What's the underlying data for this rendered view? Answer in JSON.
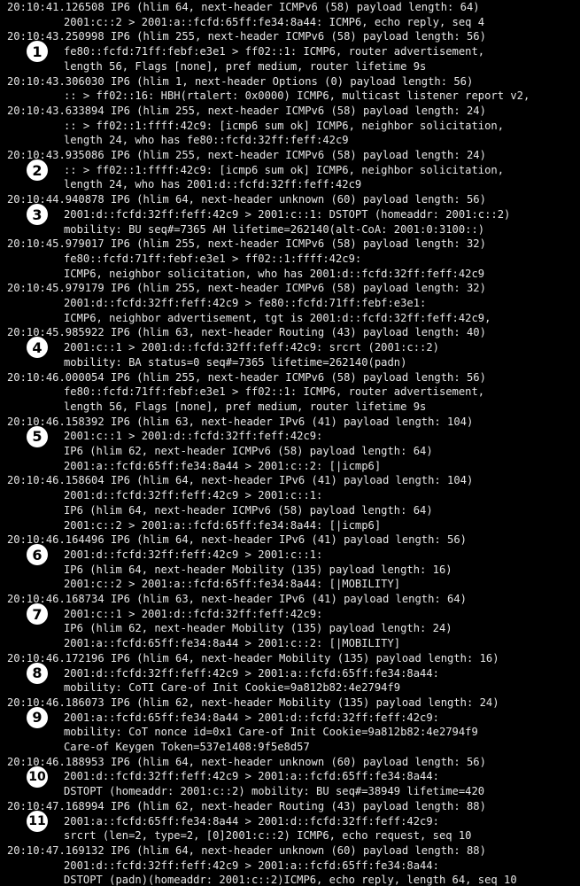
{
  "terminal": {
    "lines": [
      {
        "text": "20:10:41.126508 IP6 (hlim 64, next-header ICMPv6 (58) payload length: 64)",
        "indent": false
      },
      {
        "text": "2001:c::2 > 2001:a::fcfd:65ff:fe34:8a44: ICMP6, echo reply, seq 4",
        "indent": true
      },
      {
        "text": "20:10:43.250998 IP6 (hlim 255, next-header ICMPv6 (58) payload length: 56)",
        "indent": false
      },
      {
        "text": "fe80::fcfd:71ff:febf:e3e1 > ff02::1: ICMP6, router advertisement,",
        "indent": true
      },
      {
        "text": "length 56, Flags [none], pref medium, router lifetime 9s",
        "indent": true
      },
      {
        "text": "20:10:43.306030 IP6 (hlim 1, next-header Options (0) payload length: 56)",
        "indent": false
      },
      {
        "text": ":: > ff02::16: HBH(rtalert: 0x0000) ICMP6, multicast listener report v2,",
        "indent": true
      },
      {
        "text": "20:10:43.633894 IP6 (hlim 255, next-header ICMPv6 (58) payload length: 24)",
        "indent": false
      },
      {
        "text": ":: > ff02::1:ffff:42c9: [icmp6 sum ok] ICMP6, neighbor solicitation,",
        "indent": true
      },
      {
        "text": "length 24, who has fe80::fcfd:32ff:feff:42c9",
        "indent": true
      },
      {
        "text": "20:10:43.935086 IP6 (hlim 255, next-header ICMPv6 (58) payload length: 24)",
        "indent": false
      },
      {
        "text": ":: > ff02::1:ffff:42c9: [icmp6 sum ok] ICMP6, neighbor solicitation,",
        "indent": true
      },
      {
        "text": "length 24, who has 2001:d::fcfd:32ff:feff:42c9",
        "indent": true
      },
      {
        "text": "20:10:44.940878 IP6 (hlim 64, next-header unknown (60) payload length: 56)",
        "indent": false
      },
      {
        "text": "2001:d::fcfd:32ff:feff:42c9 > 2001:c::1: DSTOPT (homeaddr: 2001:c::2)",
        "indent": true
      },
      {
        "text": "mobility: BU seq#=7365 AH lifetime=262140(alt-CoA: 2001:0:3100::)",
        "indent": true
      },
      {
        "text": "20:10:45.979017 IP6 (hlim 255, next-header ICMPv6 (58) payload length: 32)",
        "indent": false
      },
      {
        "text": "fe80::fcfd:71ff:febf:e3e1 > ff02::1:ffff:42c9:",
        "indent": true
      },
      {
        "text": "ICMP6, neighbor solicitation, who has 2001:d::fcfd:32ff:feff:42c9",
        "indent": true
      },
      {
        "text": "20:10:45.979179 IP6 (hlim 255, next-header ICMPv6 (58) payload length: 32)",
        "indent": false
      },
      {
        "text": "2001:d::fcfd:32ff:feff:42c9 > fe80::fcfd:71ff:febf:e3e1:",
        "indent": true
      },
      {
        "text": "ICMP6, neighbor advertisement, tgt is 2001:d::fcfd:32ff:feff:42c9,",
        "indent": true
      },
      {
        "text": "20:10:45.985922 IP6 (hlim 63, next-header Routing (43) payload length: 40)",
        "indent": false
      },
      {
        "text": "2001:c::1 > 2001:d::fcfd:32ff:feff:42c9: srcrt (2001:c::2)",
        "indent": true
      },
      {
        "text": "mobility: BA status=0 seq#=7365 lifetime=262140(padn)",
        "indent": true
      },
      {
        "text": "20:10:46.000054 IP6 (hlim 255, next-header ICMPv6 (58) payload length: 56)",
        "indent": false
      },
      {
        "text": "fe80::fcfd:71ff:febf:e3e1 > ff02::1: ICMP6, router advertisement,",
        "indent": true
      },
      {
        "text": "length 56, Flags [none], pref medium, router lifetime 9s",
        "indent": true
      },
      {
        "text": "20:10:46.158392 IP6 (hlim 63, next-header IPv6 (41) payload length: 104)",
        "indent": false
      },
      {
        "text": "2001:c::1 > 2001:d::fcfd:32ff:feff:42c9:",
        "indent": true
      },
      {
        "text": "IP6 (hlim 62, next-header ICMPv6 (58) payload length: 64)",
        "indent": true
      },
      {
        "text": "2001:a::fcfd:65ff:fe34:8a44 > 2001:c::2: [|icmp6]",
        "indent": true
      },
      {
        "text": "20:10:46.158604 IP6 (hlim 64, next-header IPv6 (41) payload length: 104)",
        "indent": false
      },
      {
        "text": "2001:d::fcfd:32ff:feff:42c9 > 2001:c::1:",
        "indent": true
      },
      {
        "text": "IP6 (hlim 64, next-header ICMPv6 (58) payload length: 64)",
        "indent": true
      },
      {
        "text": "2001:c::2 > 2001:a::fcfd:65ff:fe34:8a44: [|icmp6]",
        "indent": true
      },
      {
        "text": "20:10:46.164496 IP6 (hlim 64, next-header IPv6 (41) payload length: 56)",
        "indent": false
      },
      {
        "text": "2001:d::fcfd:32ff:feff:42c9 > 2001:c::1:",
        "indent": true
      },
      {
        "text": "IP6 (hlim 64, next-header Mobility (135) payload length: 16)",
        "indent": true
      },
      {
        "text": "2001:c::2 > 2001:a::fcfd:65ff:fe34:8a44: [|MOBILITY]",
        "indent": true
      },
      {
        "text": "20:10:46.168734 IP6 (hlim 63, next-header IPv6 (41) payload length: 64)",
        "indent": false
      },
      {
        "text": "2001:c::1 > 2001:d::fcfd:32ff:feff:42c9:",
        "indent": true
      },
      {
        "text": "IP6 (hlim 62, next-header Mobility (135) payload length: 24)",
        "indent": true
      },
      {
        "text": "2001:a::fcfd:65ff:fe34:8a44 > 2001:c::2: [|MOBILITY]",
        "indent": true
      },
      {
        "text": "20:10:46.172196 IP6 (hlim 64, next-header Mobility (135) payload length: 16)",
        "indent": false
      },
      {
        "text": "2001:d::fcfd:32ff:feff:42c9 > 2001:a::fcfd:65ff:fe34:8a44:",
        "indent": true
      },
      {
        "text": "mobility: CoTI Care-of Init Cookie=9a812b82:4e2794f9",
        "indent": true
      },
      {
        "text": "20:10:46.186073 IP6 (hlim 62, next-header Mobility (135) payload length: 24)",
        "indent": false
      },
      {
        "text": "2001:a::fcfd:65ff:fe34:8a44 > 2001:d::fcfd:32ff:feff:42c9:",
        "indent": true
      },
      {
        "text": "mobility: CoT nonce id=0x1 Care-of Init Cookie=9a812b82:4e2794f9",
        "indent": true
      },
      {
        "text": "Care-of Keygen Token=537e1408:9f5e8d57",
        "indent": true
      },
      {
        "text": "20:10:46.188953 IP6 (hlim 64, next-header unknown (60) payload length: 56)",
        "indent": false
      },
      {
        "text": "2001:d::fcfd:32ff:feff:42c9 > 2001:a::fcfd:65ff:fe34:8a44:",
        "indent": true
      },
      {
        "text": "DSTOPT (homeaddr: 2001:c::2) mobility: BU seq#=38949 lifetime=420",
        "indent": true
      },
      {
        "text": "20:10:47.168994 IP6 (hlim 62, next-header Routing (43) payload length: 88)",
        "indent": false
      },
      {
        "text": "2001:a::fcfd:65ff:fe34:8a44 > 2001:d::fcfd:32ff:feff:42c9:",
        "indent": true
      },
      {
        "text": "srcrt (len=2, type=2, [0]2001:c::2) ICMP6, echo request, seq 10",
        "indent": true
      },
      {
        "text": "20:10:47.169132 IP6 (hlim 64, next-header unknown (60) payload length: 88)",
        "indent": false
      },
      {
        "text": "2001:d::fcfd:32ff:feff:42c9 > 2001:a::fcfd:65ff:fe34:8a44:",
        "indent": true
      },
      {
        "text": "DSTOPT (padn)(homeaddr: 2001:c::2)ICMP6, echo reply, length 64, seq 10",
        "indent": true
      }
    ],
    "markers": [
      {
        "label": "1",
        "line": 3
      },
      {
        "label": "2",
        "line": 11
      },
      {
        "label": "3",
        "line": 14
      },
      {
        "label": "4",
        "line": 23
      },
      {
        "label": "5",
        "line": 29
      },
      {
        "label": "6",
        "line": 37
      },
      {
        "label": "7",
        "line": 41
      },
      {
        "label": "8",
        "line": 45
      },
      {
        "label": "9",
        "line": 48
      },
      {
        "label": "10",
        "line": 52
      },
      {
        "label": "11",
        "line": 55
      }
    ]
  }
}
